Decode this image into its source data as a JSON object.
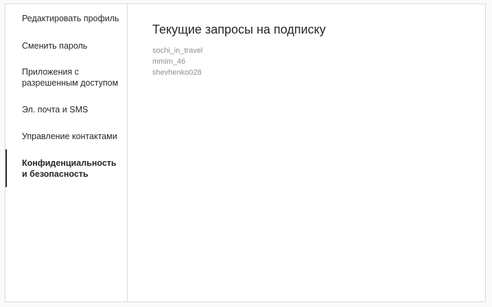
{
  "sidebar": {
    "items": [
      {
        "label": "Редактировать профиль",
        "active": false
      },
      {
        "label": "Сменить пароль",
        "active": false
      },
      {
        "label": "Приложения с разрешенным доступом",
        "active": false
      },
      {
        "label": "Эл. почта и SMS",
        "active": false
      },
      {
        "label": "Управление контактами",
        "active": false
      },
      {
        "label": "Конфиденциальность и безопасность",
        "active": true
      }
    ]
  },
  "main": {
    "title": "Текущие запросы на подписку",
    "requests": [
      "sochi_in_travel",
      "mmim_46",
      "shevhenko028"
    ]
  },
  "colors": {
    "border": "#dbdbdb",
    "text_primary": "#262626",
    "text_secondary": "#8e8e8e",
    "background": "#ffffff"
  }
}
